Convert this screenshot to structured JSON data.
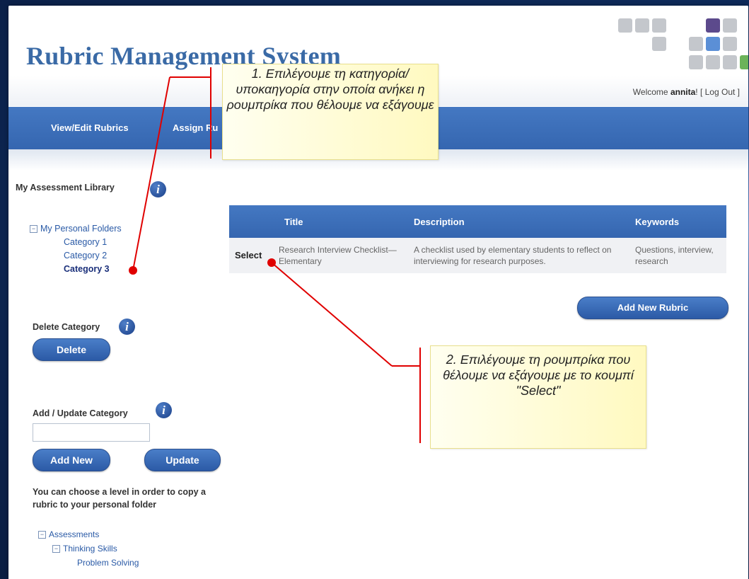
{
  "app": {
    "title": "Rubric Management System"
  },
  "user": {
    "welcome_prefix": "Welcome ",
    "name": "annita",
    "suffix": "! [ ",
    "logout": "Log Out",
    "close": " ]"
  },
  "nav": {
    "items": [
      "View/Edit Rubrics",
      "Assign Ru"
    ]
  },
  "sidebar": {
    "library_heading": "My Assessment Library",
    "personal_folders": "My Personal Folders",
    "categories": [
      "Category 1",
      "Category 2",
      "Category 3"
    ],
    "delete_heading": "Delete Category",
    "delete_button": "Delete",
    "add_update_heading": "Add / Update Category",
    "category_input_value": "",
    "add_new_button": "Add New",
    "update_button": "Update",
    "copy_note": "You can choose a level in order to copy a rubric to your personal folder",
    "tree": {
      "root": "Assessments",
      "child": "Thinking Skills",
      "leaf": "Problem Solving"
    }
  },
  "rubric_table": {
    "columns": [
      "",
      "Title",
      "Description",
      "Keywords"
    ],
    "rows": [
      {
        "action": "Select",
        "title": "Research Interview Checklist—Elementary",
        "description": "A checklist used by elementary students to reflect on interviewing for research purposes.",
        "keywords": "Questions, interview, research"
      }
    ]
  },
  "add_rubric_button": "Add New Rubric",
  "callouts": {
    "one": "1. Επιλέγουμε τη κατηγορία/υποκαηγορία στην οποία ανήκει η ρουμπρίκα που θέλουμε να εξάγουμε",
    "two": "2. Επιλέγουμε τη ρουμπρίκα που θέλουμε να εξάγουμε με το κουμπί \"Select\""
  },
  "colors": {
    "brand_blue": "#3a6aa6",
    "nav_blue": "#3a6cb8",
    "callout_yellow": "#fff9c0",
    "annotation_red": "#e00000",
    "tile_gray": "#c4c7cc",
    "tile_purple": "#5c4a8c",
    "tile_blue": "#5b8fd6",
    "tile_green": "#6cb35a"
  },
  "icons": {
    "info": "info-icon",
    "expand": "minus-box-icon"
  }
}
